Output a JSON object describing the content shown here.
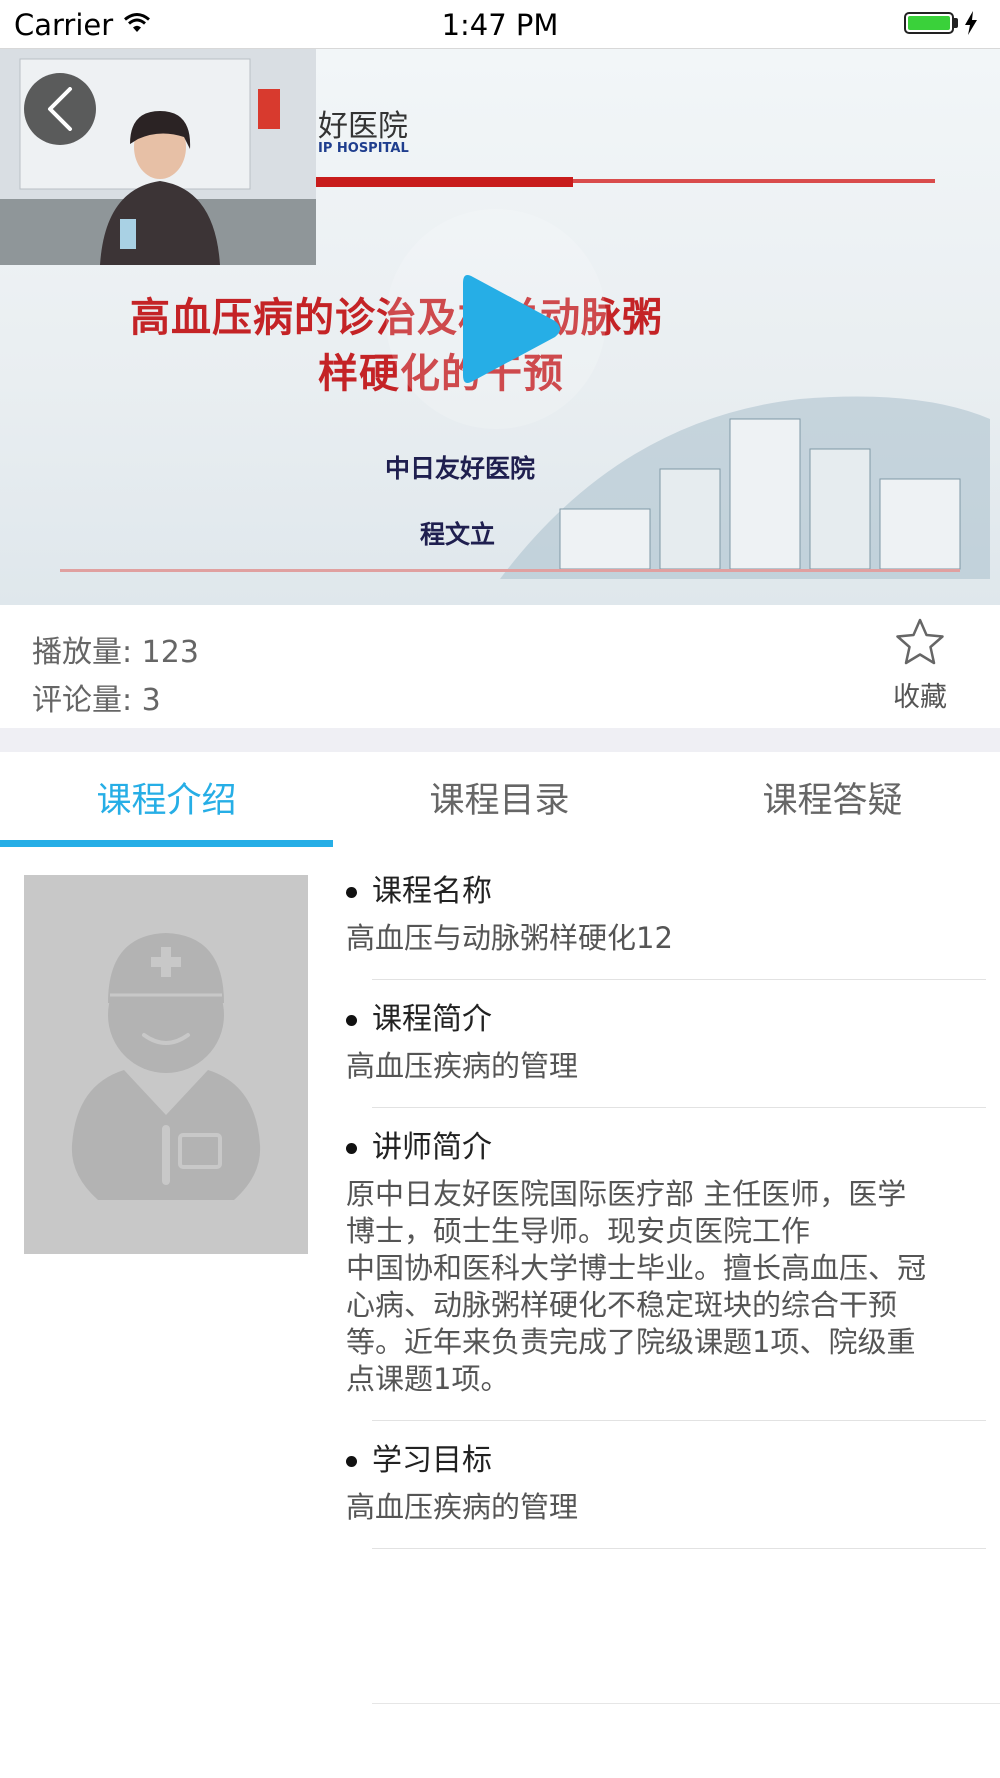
{
  "status_bar": {
    "carrier": "Carrier",
    "time": "1:47 PM"
  },
  "video": {
    "slide_logo": "好医院",
    "slide_logo_sub": "IP HOSPITAL",
    "slide_title_line1": "高血压病的诊治及相关动脉粥",
    "slide_title_line2": "样硬化的干预",
    "slide_hospital": "中日友好医院",
    "slide_presenter": "程文立"
  },
  "stats": {
    "plays": "播放量: 123",
    "comments": "评论量: 3",
    "favorite_label": "收藏"
  },
  "tabs": [
    {
      "label": "课程介绍",
      "active": true
    },
    {
      "label": "课程目录",
      "active": false
    },
    {
      "label": "课程答疑",
      "active": false
    }
  ],
  "sections": [
    {
      "title": "课程名称",
      "body": "高血压与动脉粥样硬化12"
    },
    {
      "title": "课程简介",
      "body": "高血压疾病的管理"
    },
    {
      "title": "讲师简介",
      "body": "原中日友好医院国际医疗部 主任医师，医学\n博士，硕士生导师。现安贞医院工作\n中国协和医科大学博士毕业。擅长高血压、冠\n心病、动脉粥样硬化不稳定斑块的综合干预\n等。近年来负责完成了院级课题1项、院级重\n点课题1项。"
    },
    {
      "title": "学习目标",
      "body": "高血压疾病的管理"
    }
  ],
  "colors": {
    "accent": "#26aee6",
    "separator": "#efeff4"
  },
  "icons": [
    "wifi-icon",
    "battery-icon",
    "charging-icon",
    "back-icon",
    "play-icon",
    "star-icon",
    "doctor-avatar-icon"
  ]
}
